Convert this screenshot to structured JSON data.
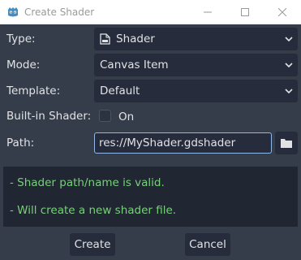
{
  "window": {
    "title": "Create Shader",
    "app_icon": "godot-icon"
  },
  "form": {
    "type": {
      "label": "Type:",
      "value": "Shader",
      "icon": "shader-file-icon"
    },
    "mode": {
      "label": "Mode:",
      "value": "Canvas Item"
    },
    "template": {
      "label": "Template:",
      "value": "Default"
    },
    "builtin": {
      "label": "Built-in Shader:",
      "checkbox_label": "On",
      "checked": false
    },
    "path": {
      "label": "Path:",
      "value": "res://MyShader.gdshader"
    }
  },
  "status": {
    "lines": [
      "- Shader path/name is valid.",
      "- Will create a new shader file."
    ],
    "color": "#78d07a"
  },
  "buttons": {
    "create": "Create",
    "cancel": "Cancel"
  },
  "colors": {
    "background": "#363d4a",
    "field": "#262c3b",
    "focus_border": "#8fb7e8"
  }
}
